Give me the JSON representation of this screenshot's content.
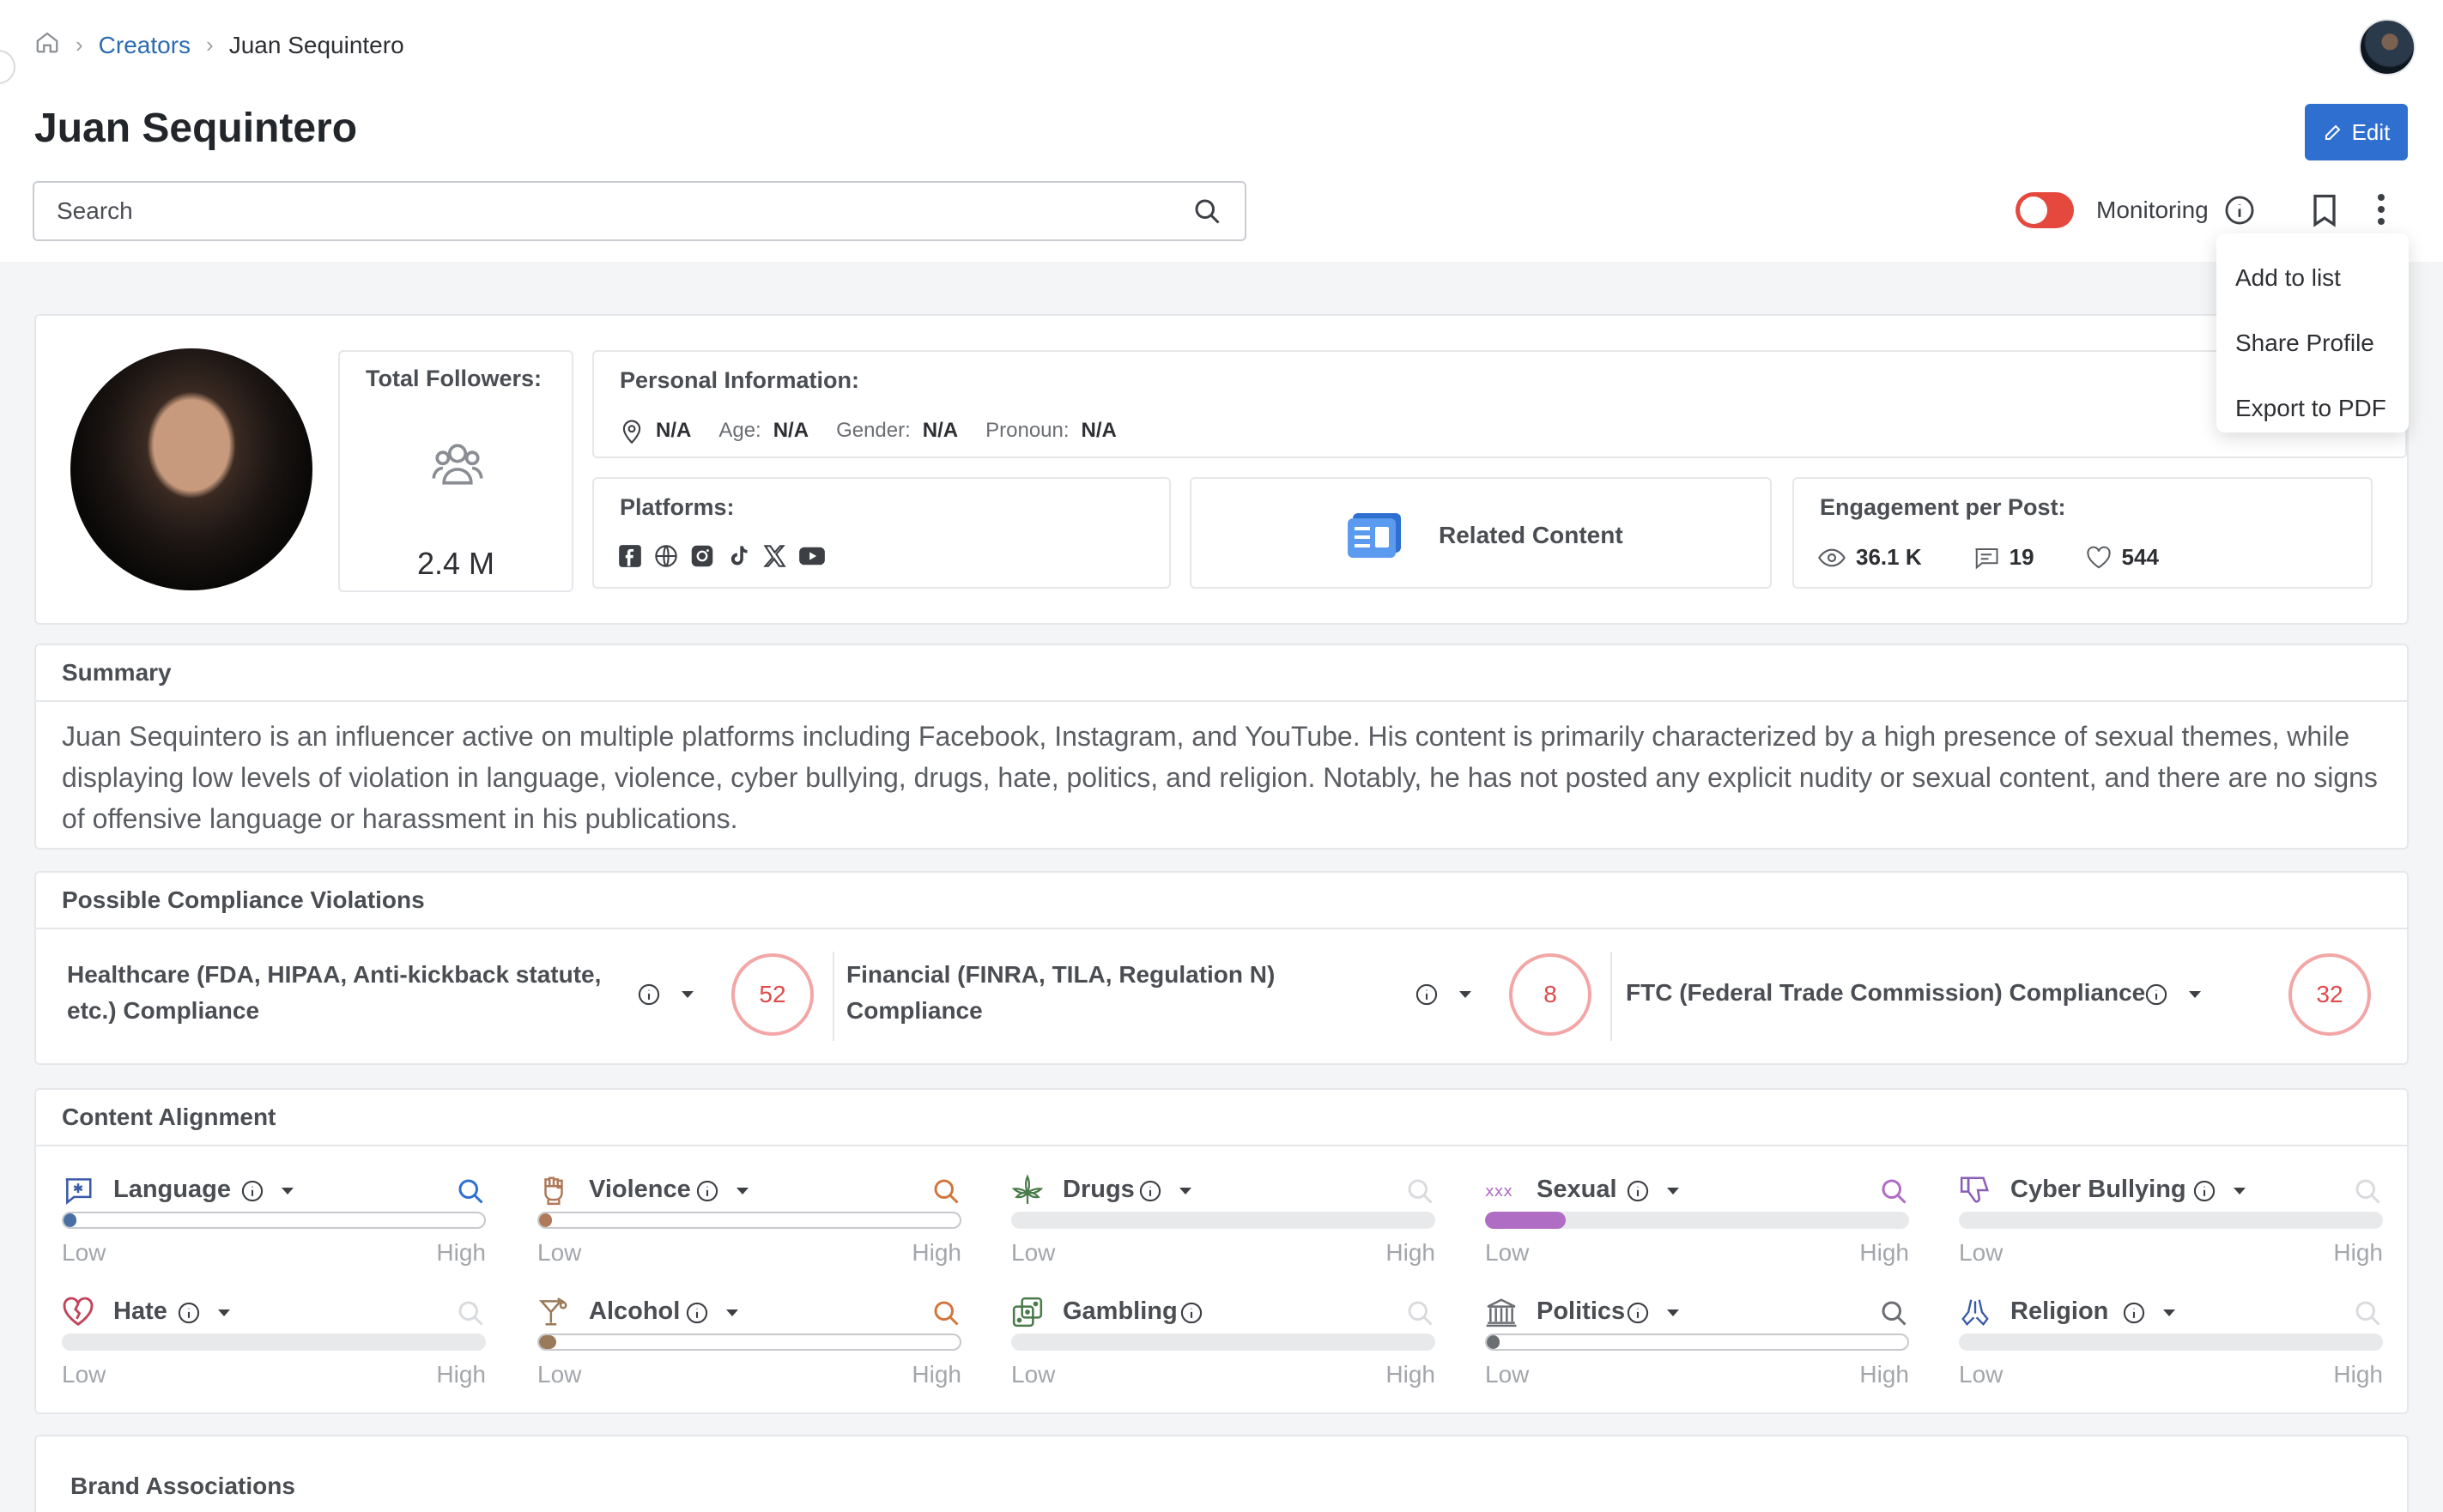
{
  "breadcrumb": {
    "home_icon": "home-icon",
    "creators": "Creators",
    "current": "Juan Sequintero"
  },
  "header": {
    "title": "Juan Sequintero",
    "edit_label": "Edit"
  },
  "search": {
    "placeholder": "Search"
  },
  "monitoring": {
    "label": "Monitoring",
    "enabled": false,
    "toggle_color": "#e5483d"
  },
  "menu": {
    "items": [
      "Add to list",
      "Share Profile",
      "Export to PDF"
    ]
  },
  "profile": {
    "followers_title": "Total Followers:",
    "followers_value": "2.4 M",
    "personal_title": "Personal Information:",
    "location": "N/A",
    "age_label": "Age:",
    "age": "N/A",
    "gender_label": "Gender:",
    "gender": "N/A",
    "pronoun_label": "Pronoun:",
    "pronoun": "N/A",
    "platforms_title": "Platforms:",
    "platform_icons": [
      "facebook-icon",
      "web-icon",
      "instagram-icon",
      "tiktok-icon",
      "x-icon",
      "youtube-icon"
    ],
    "related_label": "Related Content",
    "engagement_title": "Engagement per Post:",
    "views": "36.1 K",
    "comments": "19",
    "likes": "544"
  },
  "summary": {
    "title": "Summary",
    "text": "Juan Sequintero is an influencer active on multiple platforms including Facebook, Instagram, and YouTube. His content is primarily characterized by a high presence of sexual themes, while displaying low levels of violation in language, violence, cyber bullying, drugs, hate, politics, and religion. Notably, he has not posted any explicit nudity or sexual content, and there are no signs of offensive language or harassment in his publications."
  },
  "compliance": {
    "title": "Possible Compliance Violations",
    "items": [
      {
        "label": "Healthcare (FDA, HIPAA, Anti-kickback statute, etc.) Compliance",
        "score": "52"
      },
      {
        "label": "Financial (FINRA, TILA, Regulation N) Compliance",
        "score": "8"
      },
      {
        "label": "FTC (Federal Trade Commission) Compliance",
        "score": "32"
      }
    ],
    "ring_color": "#e04a4a"
  },
  "alignment": {
    "title": "Content Alignment",
    "low_label": "Low",
    "high_label": "High",
    "categories": [
      {
        "label": "Language",
        "icon": "language-icon",
        "level": 0.02,
        "color": "#4a6fa5",
        "has_dropdown": true,
        "search_active": true
      },
      {
        "label": "Violence",
        "icon": "violence-fist-icon",
        "level": 0.02,
        "color": "#b07a5a",
        "has_dropdown": true,
        "search_active": true
      },
      {
        "label": "Drugs",
        "icon": "cannabis-leaf-icon",
        "level": 0,
        "color": "#5a8a5a",
        "has_dropdown": true,
        "search_active": false
      },
      {
        "label": "Sexual",
        "icon": "xxx-icon",
        "level": 0.19,
        "color": "#b06dc4",
        "has_dropdown": true,
        "search_active": true
      },
      {
        "label": "Cyber Bullying",
        "icon": "thumbs-down-icon",
        "level": 0,
        "color": "#8a5fb8",
        "has_dropdown": true,
        "search_active": false
      },
      {
        "label": "Hate",
        "icon": "broken-heart-icon",
        "level": 0,
        "color": "#c2425a",
        "has_dropdown": true,
        "search_active": false
      },
      {
        "label": "Alcohol",
        "icon": "cocktail-icon",
        "level": 0.04,
        "color": "#9a7a5a",
        "has_dropdown": true,
        "search_active": true
      },
      {
        "label": "Gambling",
        "icon": "dice-icon",
        "level": 0,
        "color": "#5a8a5a",
        "has_dropdown": false,
        "search_active": false
      },
      {
        "label": "Politics",
        "icon": "capitol-icon",
        "level": 0.01,
        "color": "#6b6e73",
        "has_dropdown": true,
        "search_active": true
      },
      {
        "label": "Religion",
        "icon": "praying-hands-icon",
        "level": 0,
        "color": "#3a5aa8",
        "has_dropdown": true,
        "search_active": false
      }
    ]
  },
  "brand": {
    "title": "Brand Associations"
  }
}
